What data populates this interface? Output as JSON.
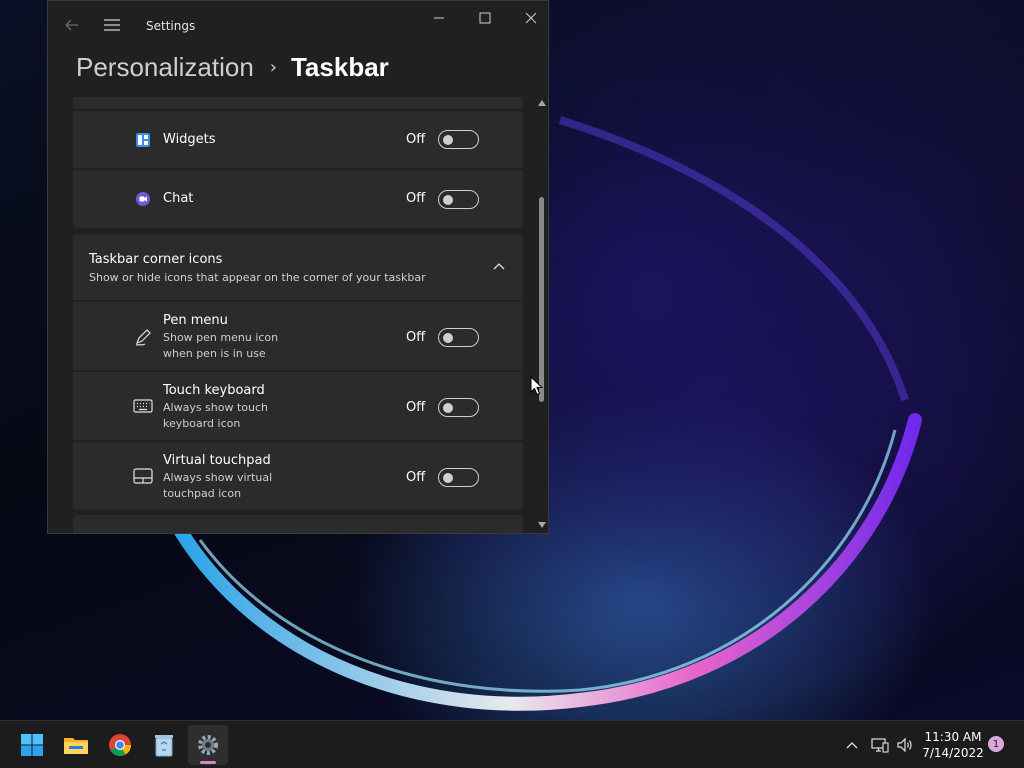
{
  "window": {
    "app_title": "Settings",
    "breadcrumb": {
      "parent": "Personalization",
      "separator": "›",
      "current": "Taskbar"
    }
  },
  "taskbar_items": [
    {
      "label": "Widgets",
      "state": "Off",
      "on": false
    },
    {
      "label": "Chat",
      "state": "Off",
      "on": false
    }
  ],
  "corner_icons": {
    "title": "Taskbar corner icons",
    "subtitle": "Show or hide icons that appear on the corner of your taskbar",
    "expanded": true,
    "items": [
      {
        "label": "Pen menu",
        "desc": "Show pen menu icon when pen is in use",
        "state": "Off",
        "on": false
      },
      {
        "label": "Touch keyboard",
        "desc": "Always show touch keyboard icon",
        "state": "Off",
        "on": false
      },
      {
        "label": "Virtual touchpad",
        "desc": "Always show virtual touchpad icon",
        "state": "Off",
        "on": false
      }
    ]
  },
  "taskbar": {
    "apps": [
      "start-icon",
      "file-explorer-icon",
      "chrome-icon",
      "recycle-bin-icon",
      "settings-icon"
    ],
    "active_app": "settings-icon",
    "clock": {
      "time": "11:30 AM",
      "date": "7/14/2022"
    },
    "notification_count": "1"
  },
  "colors": {
    "window_bg": "#202020",
    "card_bg": "#2b2b2b",
    "taskbar_bg": "#1c1c1c",
    "accent_indicator": "#d48bbf"
  }
}
